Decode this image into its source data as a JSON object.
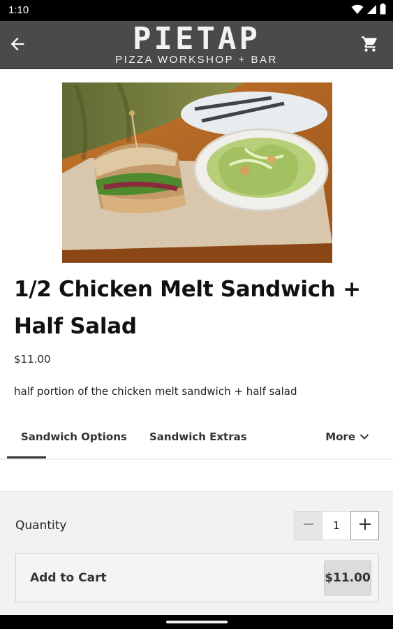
{
  "status_bar": {
    "time": "1:10",
    "icons": [
      "wifi-icon",
      "signal-icon",
      "battery-icon"
    ]
  },
  "app_bar": {
    "logo_title": "PIETAP",
    "logo_subtitle": "PIZZA WORKSHOP + BAR",
    "icons": [
      "back-arrow-icon",
      "cart-icon"
    ]
  },
  "item": {
    "title": "1/2 Chicken Melt Sandwich + Half Salad",
    "price": "$11.00",
    "description": "half portion of the chicken melt sandwich + half salad"
  },
  "tabs": {
    "items": [
      {
        "label": "Sandwich Options",
        "selected": true
      },
      {
        "label": "Sandwich Extras",
        "selected": false
      }
    ],
    "more_label": "More"
  },
  "order": {
    "quantity_label": "Quantity",
    "quantity_value": "1",
    "add_to_cart_label": "Add to Cart",
    "add_to_cart_price": "$11.00"
  },
  "colors": {
    "app_bar": "#4a4a4a",
    "status_bar": "#000000",
    "panel": "#f2f2f2"
  }
}
